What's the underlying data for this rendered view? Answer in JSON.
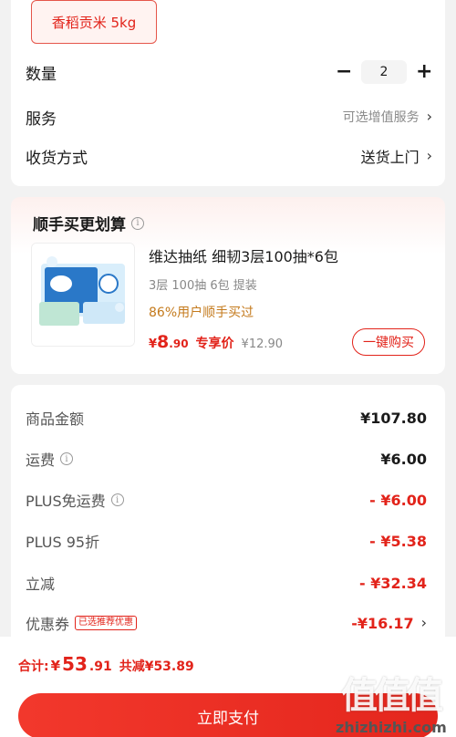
{
  "options": {
    "spec_chip": "香稻贡米 5kg",
    "quantity": {
      "label": "数量",
      "minus": "−",
      "value": "2",
      "plus": "+"
    },
    "service": {
      "label": "服务",
      "value": "可选增值服务"
    },
    "delivery": {
      "label": "收货方式",
      "value": "送货上门"
    }
  },
  "addon": {
    "title": "顺手买更划算",
    "product_name": "维达抽纸 细韧3层100抽*6包",
    "spec": "3层 100抽 6包 提装",
    "tag": "86%用户顺手买过",
    "price_currency": "¥",
    "price_int": "8",
    "price_dec": ".90",
    "price_label": "专享价",
    "original_price": "¥12.90",
    "buy_button": "一键购买"
  },
  "fees": [
    {
      "label": "商品金额",
      "value": "¥107.80",
      "style": "black",
      "info": false
    },
    {
      "label": "运费",
      "value": "¥6.00",
      "style": "normal",
      "info": true
    },
    {
      "label": "PLUS免运费",
      "value": "- ¥6.00",
      "style": "red",
      "info": true
    },
    {
      "label": "PLUS 95折",
      "value": "- ¥5.38",
      "style": "red",
      "info": false
    },
    {
      "label": "立减",
      "value": "- ¥32.34",
      "style": "red",
      "info": false
    },
    {
      "label": "优惠券",
      "badge": "已选推荐优惠",
      "value": "-¥16.17",
      "style": "red",
      "info": false
    }
  ],
  "bottom": {
    "total_label": "合计:",
    "total_currency": "¥",
    "total_int": "53",
    "total_dec": ".91",
    "saved": "共减¥53.89",
    "pay_button": "立即支付"
  },
  "watermark": {
    "glyphs": "值值值",
    "url": "zhizhizhi.com"
  },
  "colors": {
    "accent": "#e2231a",
    "tag": "#c47a1c",
    "background": "#f2f2f2"
  },
  "icons": {
    "chevron": "chevron-right-icon",
    "info": "info-circle-icon"
  }
}
